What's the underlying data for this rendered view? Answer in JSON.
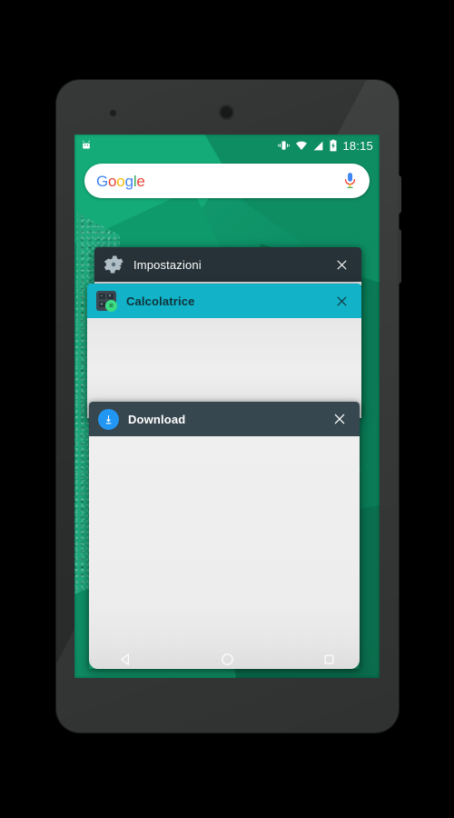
{
  "device": {
    "name": "android-phone",
    "frame_color": "#2e3030"
  },
  "status_bar": {
    "notification_icon": "android-robot-icon",
    "icons": [
      "vibrate-icon",
      "wifi-icon",
      "cellular-signal-icon",
      "battery-charging-icon"
    ],
    "clock": "18:15"
  },
  "search": {
    "logo_letters": [
      {
        "char": "G",
        "color": "#4285F4"
      },
      {
        "char": "o",
        "color": "#EA4335"
      },
      {
        "char": "o",
        "color": "#FBBC05"
      },
      {
        "char": "g",
        "color": "#4285F4"
      },
      {
        "char": "l",
        "color": "#34A853"
      },
      {
        "char": "e",
        "color": "#EA4335"
      }
    ],
    "logo_text": "Google",
    "placeholder": "Google",
    "mic_icon": "microphone-icon"
  },
  "recents": {
    "screen_name": "recent-apps-overview",
    "cards": [
      {
        "id": "impostazioni",
        "title": "Impostazioni",
        "icon": "settings-gear-icon",
        "header_color": "#263238",
        "title_color": "#ffffff",
        "close_label": "×",
        "close_icon": "close-icon"
      },
      {
        "id": "calcolatrice",
        "title": "Calcolatrice",
        "icon": "calculator-icon",
        "header_color": "#12b2c8",
        "title_color": "#10333a",
        "close_label": "×",
        "close_icon": "close-icon",
        "keys": [
          "−",
          "×",
          "+",
          "="
        ]
      },
      {
        "id": "download",
        "title": "Download",
        "icon": "download-arrow-icon",
        "header_color": "#37474f",
        "title_color": "#ffffff",
        "close_label": "×",
        "close_icon": "close-icon"
      }
    ]
  },
  "nav_bar": {
    "back": "back-triangle-icon",
    "home": "home-circle-icon",
    "recents": "recents-square-icon"
  },
  "wallpaper": {
    "name": "android-geometric-green-wallpaper",
    "colors": [
      "#14ab78",
      "#0e8d63",
      "#0f9a6c",
      "#0a7b56",
      "#2bbd8e",
      "#0a6f4e"
    ]
  }
}
